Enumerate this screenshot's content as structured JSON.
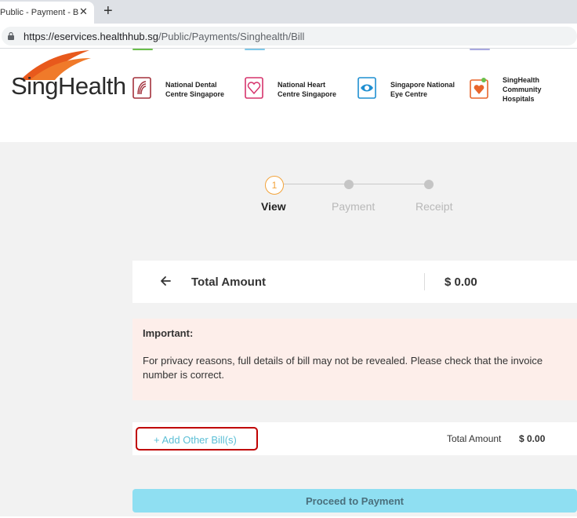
{
  "browser": {
    "tab_title": "Public - Payment - Bill",
    "close_glyph": "✕",
    "new_tab_glyph": "+",
    "url_host": "https://eservices.healthhub.sg",
    "url_path": "/Public/Payments/Singhealth/Bill"
  },
  "header": {
    "logo_text": "SingHealth",
    "institutions": [
      {
        "line1": "National Dental",
        "line2": "Centre Singapore",
        "line3": ""
      },
      {
        "line1": "National Heart",
        "line2": "Centre Singapore",
        "line3": ""
      },
      {
        "line1": "Singapore National",
        "line2": "Eye Centre",
        "line3": ""
      },
      {
        "line1": "SingHealth",
        "line2": "Community",
        "line3": "Hospitals"
      }
    ]
  },
  "stepper": {
    "active_number": "1",
    "steps": [
      {
        "label": "View",
        "active": true
      },
      {
        "label": "Payment",
        "active": false
      },
      {
        "label": "Receipt",
        "active": false
      }
    ]
  },
  "total_card": {
    "label": "Total Amount",
    "value": "$ 0.00"
  },
  "important": {
    "title": "Important:",
    "message": "For privacy reasons, full details of bill may not be revealed. Please check that the invoice number is correct."
  },
  "bill_row": {
    "add_label": "+ Add Other Bill(s)",
    "total_label": "Total Amount",
    "total_value": "$ 0.00"
  },
  "proceed": {
    "label": "Proceed to Payment"
  },
  "colors": {
    "accent_orange": "#f3a33a",
    "link_blue": "#5cbfd6",
    "button_cyan": "#8fdff2",
    "highlight_red": "#c00000",
    "notice_bg": "#fdeeea"
  }
}
